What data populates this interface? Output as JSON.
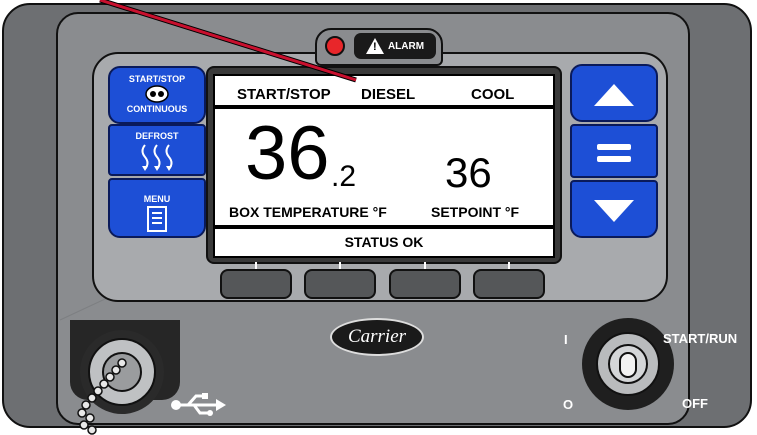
{
  "alarm": {
    "label": "ALARM",
    "icon": "warning-triangle-icon",
    "led_color": "#e8262a"
  },
  "left_buttons": {
    "startstop_top": "START/STOP",
    "startstop_bottom": "CONTINUOUS",
    "defrost": "DEFROST",
    "menu": "MENU"
  },
  "right_buttons": {
    "up_icon": "up-arrow-icon",
    "select_icon": "equals-icon",
    "down_icon": "down-arrow-icon"
  },
  "display": {
    "mode": "START/STOP",
    "fuel": "DIESEL",
    "operation": "COOL",
    "box_temp_whole": "36",
    "box_temp_decimal": ".2",
    "setpoint": "36",
    "box_temp_label": "BOX TEMPERATURE °F",
    "setpoint_label": "SETPOINT °F",
    "status": "STATUS OK"
  },
  "brand": "Carrier",
  "switch": {
    "on_label": "I",
    "off_label": "O",
    "start_run": "START/RUN",
    "off": "OFF"
  },
  "colors": {
    "button_blue": "#1d4fd6",
    "housing_gray": "#6d6f72",
    "pointer_red": "#c8102e"
  }
}
